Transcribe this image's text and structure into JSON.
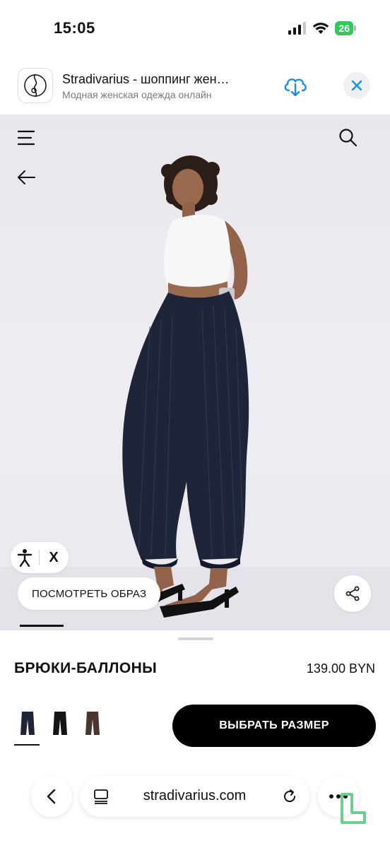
{
  "status_bar": {
    "time": "15:05",
    "battery": "26"
  },
  "app_banner": {
    "title": "Stradivarius - шоппинг жен…",
    "subtitle": "Модная женская одежда онлайн",
    "accent_color": "#1a8ee6"
  },
  "gallery": {
    "look_button_label": "ПОСМОТРЕТЬ ОБРАЗ",
    "accessibility_close": "X"
  },
  "product": {
    "name": "БРЮКИ-БАЛЛОНЫ",
    "price": "139.00 BYN",
    "select_size_label": "ВЫБРАТЬ РАЗМЕР",
    "color_swatches": [
      {
        "name": "navy-pinstripe",
        "color": "#1f2538",
        "selected": true
      },
      {
        "name": "black",
        "color": "#151515",
        "selected": false
      },
      {
        "name": "brown",
        "color": "#4a3530",
        "selected": false
      }
    ]
  },
  "browser": {
    "url": "stradivarius.com"
  }
}
